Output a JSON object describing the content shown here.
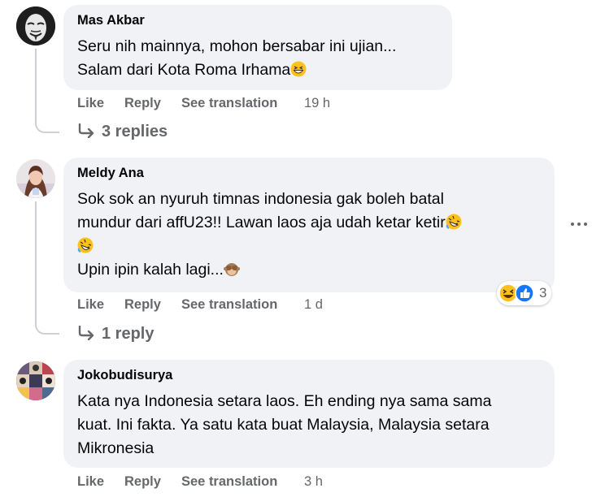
{
  "comments": [
    {
      "author": "Mas Akbar",
      "lines": [
        "Seru nih mainnya, mohon bersabar ini ujian...",
        "Salam dari Kota Roma Irhama"
      ],
      "line_emojis": [
        "",
        "grinning-squint-emoji"
      ],
      "actions": {
        "like": "Like",
        "reply": "Reply",
        "translate": "See translation",
        "time": "19 h"
      },
      "replies": "3 replies"
    },
    {
      "author": "Meldy Ana",
      "lines": [
        "Sok sok an nyuruh timnas indonesia gak boleh batal",
        "mundur dari affU23!! Lawan laos aja udah ketar ketir",
        "",
        "Upin ipin kalah lagi..."
      ],
      "line_emojis": [
        "",
        "rolling-laughing-emoji",
        "rolling-laughing-emoji",
        "see-no-evil-monkey-emoji"
      ],
      "actions": {
        "like": "Like",
        "reply": "Reply",
        "translate": "See translation",
        "time": "1 d"
      },
      "reactions": {
        "icons": [
          "laughing-reaction-icon",
          "like-reaction-icon"
        ],
        "count": "3"
      },
      "replies": "1 reply"
    },
    {
      "author": "Jokobudisurya",
      "lines": [
        "Kata nya Indonesia setara laos. Eh ending nya sama sama",
        "kuat. Ini fakta. Ya satu kata buat Malaysia, Malaysia setara",
        "Mikronesia"
      ],
      "actions": {
        "like": "Like",
        "reply": "Reply",
        "translate": "See translation",
        "time": "3 h"
      }
    }
  ],
  "colors": {
    "bubble": "#f0f2f5",
    "secondary_text": "#65676b",
    "thread_line": "#ced0d4",
    "like_blue": "#1877f2",
    "emoji_yellow": "#fcc21b"
  },
  "icons": {
    "more": "more-options-icon",
    "reply_arrow": "reply-arrow-icon"
  }
}
